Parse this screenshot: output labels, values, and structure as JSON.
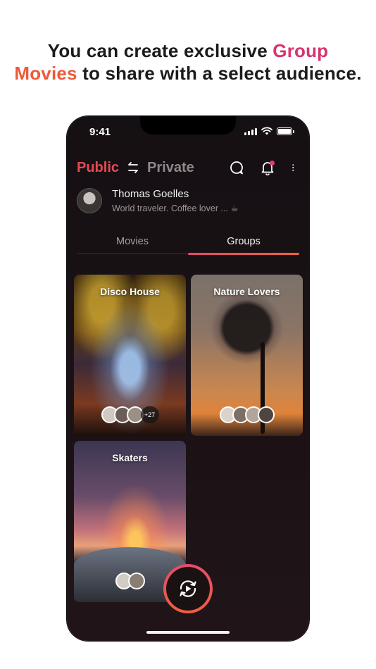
{
  "headline": {
    "part1": "You can create exclusive ",
    "accent1": "Group",
    "accent2": "Movies",
    "part2": " to share with a select audience."
  },
  "status_bar": {
    "time": "9:41",
    "icons": [
      "signal-icon",
      "wifi-icon",
      "battery-icon"
    ]
  },
  "header": {
    "public_label": "Public",
    "private_label": "Private",
    "icons": [
      "swap-icon",
      "chat-icon",
      "bell-icon",
      "more-icon"
    ],
    "notification_dot_color": "#e73a73"
  },
  "profile": {
    "name": "Thomas Goelles",
    "bio": "World traveler. Coffee lover ... ☕"
  },
  "tabs": [
    {
      "label": "Movies",
      "active": false
    },
    {
      "label": "Groups",
      "active": true
    }
  ],
  "groups": [
    {
      "title": "Disco House",
      "extra_members": "+27"
    },
    {
      "title": "Nature Lovers"
    },
    {
      "title": "Skaters"
    }
  ],
  "colors": {
    "accent_public": "#e54a52",
    "accent_gradient_start": "#e6496d",
    "accent_gradient_end": "#f0613c",
    "headline_accent1": "#d8336f",
    "headline_accent2": "#ef5a3a"
  },
  "fab": {
    "icon": "play-rewind-icon"
  }
}
